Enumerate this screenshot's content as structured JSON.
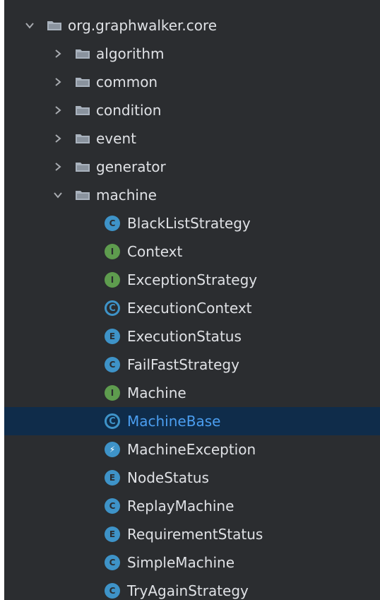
{
  "tree": {
    "root": {
      "label": "org.graphwalker.core",
      "expanded": true
    },
    "folders": [
      {
        "label": "algorithm",
        "expanded": false
      },
      {
        "label": "common",
        "expanded": false
      },
      {
        "label": "condition",
        "expanded": false
      },
      {
        "label": "event",
        "expanded": false
      },
      {
        "label": "generator",
        "expanded": false
      },
      {
        "label": "machine",
        "expanded": true
      }
    ],
    "machine_items": [
      {
        "label": "BlackListStrategy",
        "kind": "class",
        "glyph": "C"
      },
      {
        "label": "Context",
        "kind": "interface",
        "glyph": "I"
      },
      {
        "label": "ExceptionStrategy",
        "kind": "interface",
        "glyph": "I"
      },
      {
        "label": "ExecutionContext",
        "kind": "abstract-class",
        "glyph": "C"
      },
      {
        "label": "ExecutionStatus",
        "kind": "enum",
        "glyph": "E"
      },
      {
        "label": "FailFastStrategy",
        "kind": "class",
        "glyph": "C"
      },
      {
        "label": "Machine",
        "kind": "interface",
        "glyph": "I"
      },
      {
        "label": "MachineBase",
        "kind": "abstract-class",
        "glyph": "C",
        "selected": true
      },
      {
        "label": "MachineException",
        "kind": "exception",
        "glyph": "⚡"
      },
      {
        "label": "NodeStatus",
        "kind": "enum",
        "glyph": "E"
      },
      {
        "label": "ReplayMachine",
        "kind": "class",
        "glyph": "C"
      },
      {
        "label": "RequirementStatus",
        "kind": "enum",
        "glyph": "E"
      },
      {
        "label": "SimpleMachine",
        "kind": "class",
        "glyph": "C"
      },
      {
        "label": "TryAgainStrategy",
        "kind": "class",
        "glyph": "C"
      }
    ]
  },
  "colors": {
    "background": "#2b2d30",
    "selection": "#0f2c4a",
    "selected_text": "#4b9ef0",
    "class_badge": "#3e93c8",
    "interface_badge": "#5e9c4e"
  }
}
